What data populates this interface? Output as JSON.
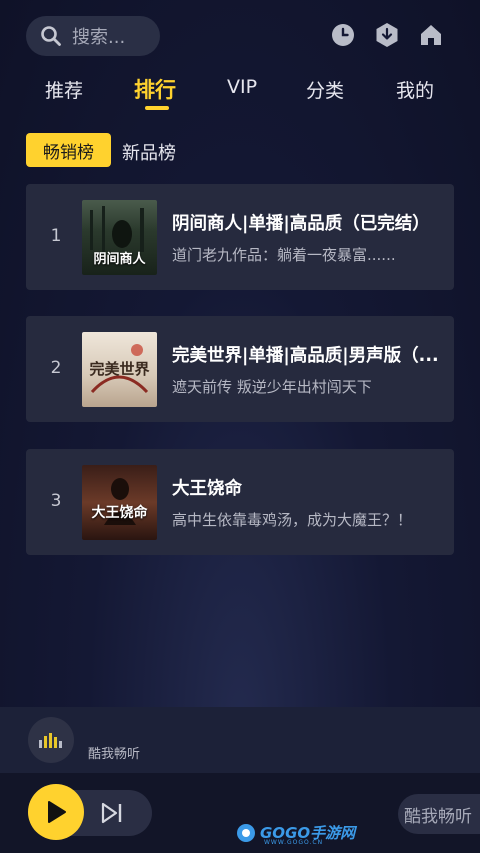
{
  "search": {
    "placeholder": "搜索..."
  },
  "header_icons": [
    "clock-icon",
    "download-icon",
    "home-icon"
  ],
  "tabs": [
    {
      "label": "推荐",
      "active": false
    },
    {
      "label": "排行",
      "active": true
    },
    {
      "label": "VIP",
      "active": false
    },
    {
      "label": "分类",
      "active": false
    },
    {
      "label": "我的",
      "active": false
    }
  ],
  "subtabs": [
    {
      "label": "畅销榜",
      "active": true
    },
    {
      "label": "新品榜",
      "active": false
    }
  ],
  "ranking": [
    {
      "rank": "1",
      "title": "阴间商人|单播|高品质（已完结）",
      "desc": "道门老九作品：躺着一夜暴富......",
      "cover_text": "阴间商人",
      "cover_color": "#2d3a2e"
    },
    {
      "rank": "2",
      "title": "完美世界|单播|高品质|男声版（...",
      "desc": "遮天前传 叛逆少年出村闯天下",
      "cover_text": "完美世界",
      "cover_color": "#d9cfc2"
    },
    {
      "rank": "3",
      "title": "大王饶命",
      "desc": "高中生依靠毒鸡汤，成为大魔王？！",
      "cover_text": "大王饶命",
      "cover_color": "#5a3226"
    }
  ],
  "mini_player": {
    "label": "酷我畅听"
  },
  "bottom": {
    "brand": "酷我畅听",
    "watermark": "GOGO手游网",
    "watermark_url": "WWW.GOGO.CN"
  },
  "colors": {
    "accent": "#ffd22e",
    "card": "#262a3e",
    "background": "#141834"
  }
}
